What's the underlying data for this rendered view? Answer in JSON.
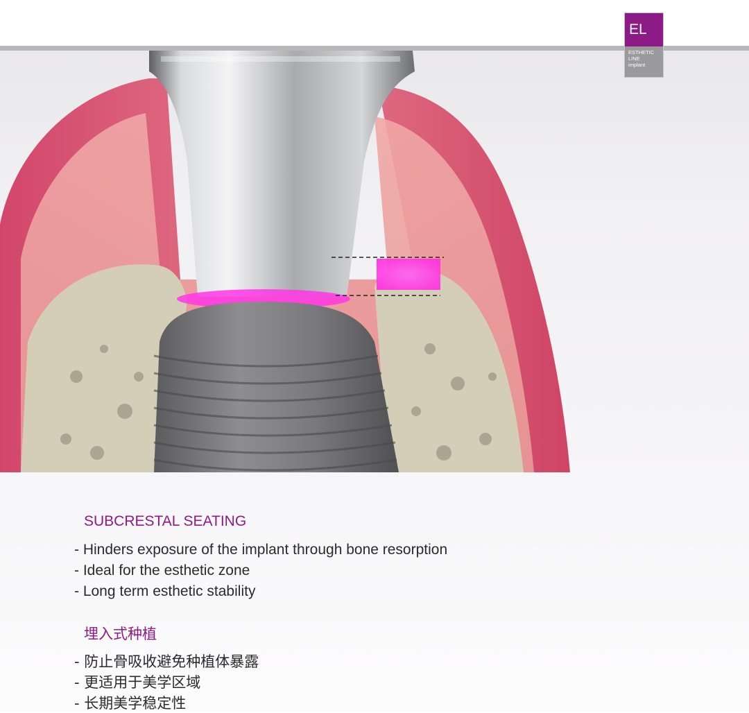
{
  "logo": {
    "code": "EL",
    "line1": "ESTHETIC",
    "line2": "LINE",
    "line3": "implant"
  },
  "colors": {
    "accent": "#8d1b87",
    "highlight": "#ff36e6",
    "gum": "#d4506c",
    "bone": "#d4cdb8",
    "titanium": "#8b8b8d"
  },
  "english": {
    "heading": "SUBCRESTAL SEATING",
    "bullets": [
      "- Hinders exposure of the implant through    bone resorption",
      "- Ideal for the esthetic zone",
      "- Long term esthetic stability"
    ]
  },
  "chinese": {
    "heading": "埋入式种植",
    "bullets": [
      "- 防止骨吸收避免种植体暴露",
      "- 更适用于美学区域",
      "- 长期美学稳定性"
    ]
  }
}
